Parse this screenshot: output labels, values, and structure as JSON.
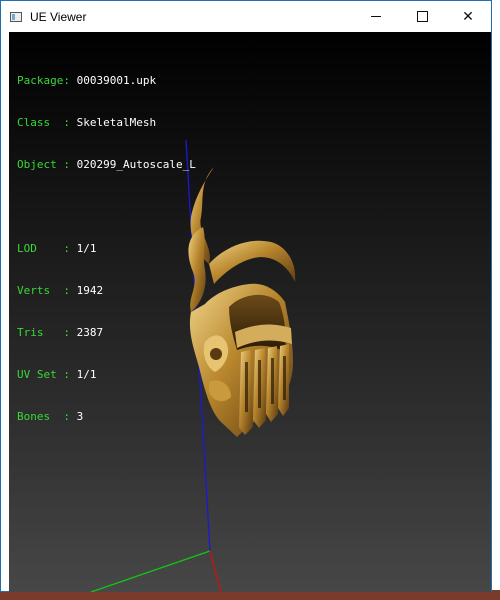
{
  "window": {
    "title": "UE Viewer",
    "controls": {
      "minimize": "–",
      "maximize": "□",
      "close": "✕"
    }
  },
  "info_top": [
    {
      "label": "Package",
      "value": "00039001.upk"
    },
    {
      "label": "Class  ",
      "value": "SkeletalMesh"
    },
    {
      "label": "Object ",
      "value": "020299_Autoscale_L"
    }
  ],
  "info_bottom": [
    {
      "label": "LOD    ",
      "value": "1/1"
    },
    {
      "label": "Verts  ",
      "value": "1942"
    },
    {
      "label": "Tris   ",
      "value": "2387"
    },
    {
      "label": "UV Set ",
      "value": "1/1"
    },
    {
      "label": "Bones  ",
      "value": "3"
    }
  ],
  "colors": {
    "label_green": "#39d839",
    "axis_x": "#d01010",
    "axis_y": "#12c712",
    "axis_z": "#1a1ad6",
    "gold": "#b8862d"
  },
  "viewport": {
    "model": "golden ornate skull mask (rendered mesh)"
  }
}
